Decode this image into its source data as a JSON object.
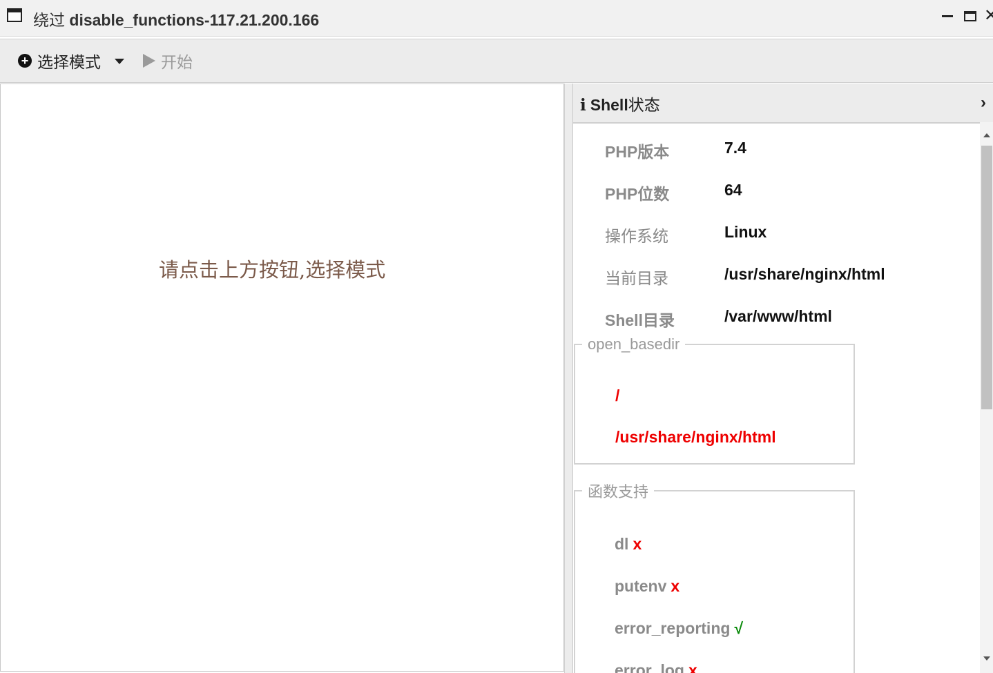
{
  "window": {
    "title_prefix": "绕过",
    "title_main": "disable_functions-117.21.200.166"
  },
  "toolbar": {
    "mode_label": "选择模式",
    "start_label": "开始"
  },
  "left_panel": {
    "placeholder": "请点击上方按钮,选择模式"
  },
  "shell_status": {
    "title_icon": "i",
    "title_en": "Shell",
    "title_zh": "状态",
    "rows": [
      {
        "label": "PHP版本",
        "value": "7.4"
      },
      {
        "label": "PHP位数",
        "value": "64"
      },
      {
        "label": "操作系统",
        "value": "Linux"
      },
      {
        "label": "当前目录",
        "value": "/usr/share/nginx/html"
      },
      {
        "label": "Shell目录",
        "value": "/var/www/html"
      }
    ],
    "open_basedir": {
      "legend": "open_basedir",
      "paths": [
        "/",
        "/usr/share/nginx/html"
      ]
    },
    "functions": {
      "legend": "函数支持",
      "items": [
        {
          "name": "dl",
          "mark": "x"
        },
        {
          "name": "putenv",
          "mark": "x"
        },
        {
          "name": "error_reporting",
          "mark": "√"
        },
        {
          "name": "error_log",
          "mark": "x"
        }
      ]
    }
  },
  "colors": {
    "unsupported": "#ee0000",
    "supported": "#0a8a0a",
    "label_gray": "#8a8a8a"
  }
}
